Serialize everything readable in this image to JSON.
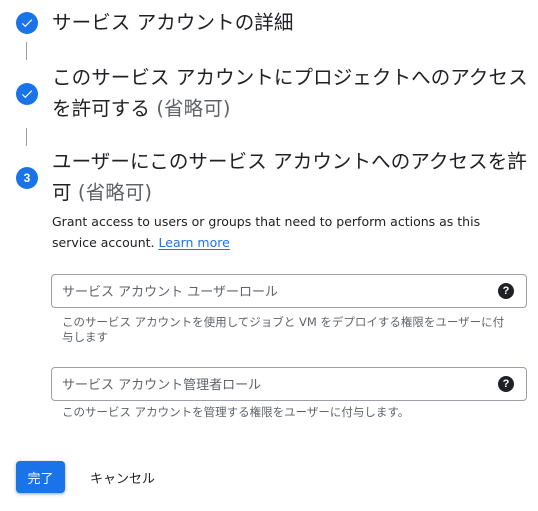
{
  "steps": [
    {
      "state": "done",
      "title": "サービス アカウントの詳細",
      "optional": ""
    },
    {
      "state": "done",
      "title": "このサービス アカウントにプロジェクトへのアクセスを許可する",
      "optional": "(省略可)"
    },
    {
      "state": "active",
      "number": "3",
      "title": "ユーザーにこのサービス アカウントへのアクセスを許可",
      "optional": "(省略可)"
    }
  ],
  "step3": {
    "description": "Grant access to users or groups that need to perform actions as this service account.",
    "learn_more": "Learn more",
    "fields": [
      {
        "placeholder": "サービス アカウント ユーザーロール",
        "value": "",
        "help": "このサービス アカウントを使用してジョブと VM をデプロイする権限をユーザーに付与します"
      },
      {
        "placeholder": "サービス アカウント管理者ロール",
        "value": "",
        "help": "このサービス アカウントを管理する権限をユーザーに付与します。"
      }
    ]
  },
  "actions": {
    "done": "完了",
    "cancel": "キャンセル"
  },
  "icons": {
    "check": "check-icon",
    "help": "help-icon"
  },
  "help_glyph": "?",
  "colors": {
    "accent": "#1a73e8",
    "text": "#202124",
    "secondary": "#5f6368",
    "border": "#9aa0a6"
  }
}
